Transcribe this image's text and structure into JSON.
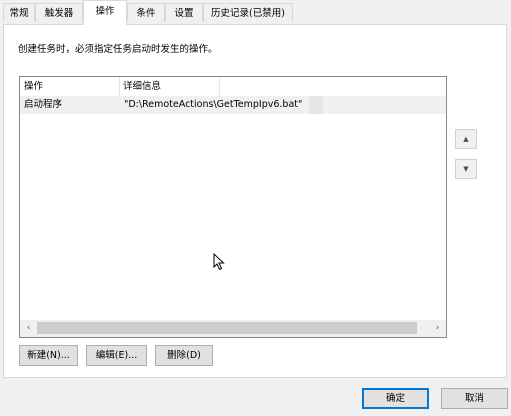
{
  "tabs": [
    "常规",
    "触发器",
    "操作",
    "条件",
    "设置",
    "历史记录(已禁用)"
  ],
  "active_tab": "操作",
  "description": "创建任务时，必须指定任务启动时发生的操作。",
  "table": {
    "columns": [
      "操作",
      "详细信息"
    ],
    "rows": [
      {
        "action": "启动程序",
        "details": "\"D:\\RemoteActions\\GetTempIpv6.bat\""
      }
    ]
  },
  "scroll": {
    "left_arrow": "‹",
    "right_arrow": "›",
    "up_glyph": "▲",
    "down_glyph": "▼"
  },
  "buttons": {
    "new": "新建(N)...",
    "edit": "编辑(E)...",
    "delete": "删除(D)",
    "ok": "确定",
    "cancel": "取消"
  }
}
